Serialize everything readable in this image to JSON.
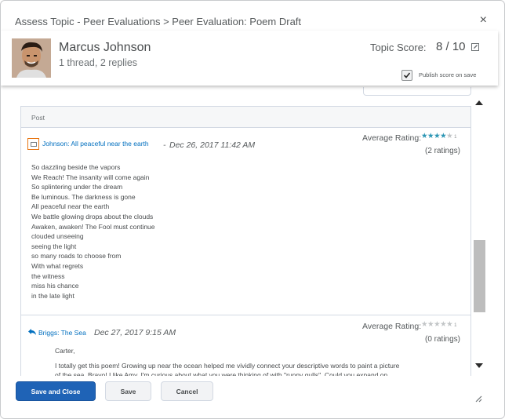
{
  "dialog": {
    "title": "Assess Topic - Peer Evaluations > Peer Evaluation: Poem Draft",
    "close_glyph": "×"
  },
  "user": {
    "name": "Marcus Johnson",
    "subtitle": "1 thread, 2 replies",
    "topic_score_label": "Topic Score:",
    "topic_score_value": "8 / 10",
    "publish_label": "Publish score on save",
    "publish_checked": true
  },
  "panel": {
    "header": "Post",
    "posts": [
      {
        "title": "Johnson: All peaceful near the earth",
        "date_prefix": "-",
        "date": "Dec 26, 2017 11:42 AM",
        "rating_label": "Average Rating:",
        "stars_filled": 4,
        "stars_total": 5,
        "stars_suffix": "1",
        "rating_count": "(2 ratings)",
        "lines": [
          "So dazzling beside the vapors",
          "We Reach! The insanity will come again",
          "So splintering under the dream",
          "Be luminous. The darkness is gone",
          "All peaceful near the earth",
          "We battle glowing drops about the clouds",
          "Awaken, awaken! The Fool must continue",
          "clouded unseeing",
          "seeing the light",
          "so many roads to choose from",
          "With what regrets",
          "the witness",
          "miss his chance",
          "in the late light"
        ]
      },
      {
        "title": "Briggs: The Sea",
        "date": "Dec 27, 2017 9:15 AM",
        "rating_label": "Average Rating:",
        "stars_filled": 0,
        "stars_total": 5,
        "stars_suffix": "1",
        "rating_count": "(0 ratings)",
        "lines": [
          "Carter,",
          "I totally get this poem! Growing up near the ocean helped me vividly connect your descriptive words to paint a picture",
          "of the sea. Bravo! I like Amy, I'm curious about what you were thinking of with \"runny gulls\". Could you expand on"
        ]
      }
    ]
  },
  "footer": {
    "save_close": "Save and Close",
    "save": "Save",
    "cancel": "Cancel"
  },
  "icons": {
    "close": "close-icon",
    "edit": "pencil-edit-icon",
    "checkbox": "checkmark-icon",
    "thread": "collapse-thread-icon",
    "reply": "reply-arrow-icon",
    "resize": "resize-grip-icon"
  },
  "colors": {
    "primary": "#1f63b6",
    "link": "#006fbf",
    "star": "#2c96b4",
    "focus": "#e87511"
  }
}
